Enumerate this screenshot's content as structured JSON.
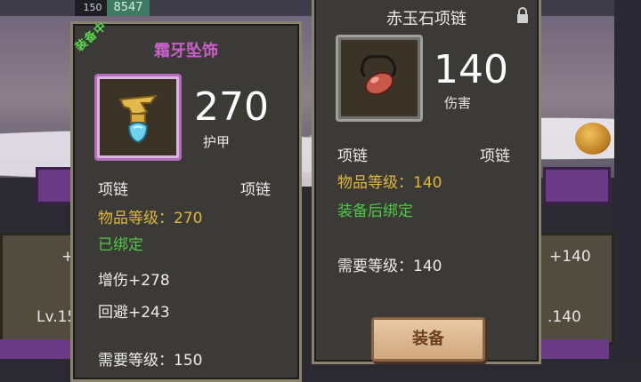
{
  "hud": {
    "level": "150",
    "exp": "8547"
  },
  "background": {
    "left_card": {
      "plus": "+",
      "level": "Lv.15"
    },
    "right_card": {
      "plus": "+140",
      "level": ".140"
    }
  },
  "left_item": {
    "badge": "装备中",
    "name": "霜牙坠饰",
    "name_color": "#c760c9",
    "icon": "frost-fang-pendant-icon",
    "stat_value": "270",
    "stat_label": "护甲",
    "type_left": "项链",
    "type_right": "项链",
    "item_level": "物品等级：270",
    "bind_status": "已绑定",
    "bonuses": [
      "增伤+278",
      "回避+243"
    ],
    "required_level": "需要等级：150"
  },
  "right_item": {
    "name": "赤玉石项链",
    "icon": "red-jade-necklace-icon",
    "lock_icon": "lock-icon",
    "stat_value": "140",
    "stat_label": "伤害",
    "type_left": "项链",
    "type_right": "项链",
    "item_level": "物品等级：140",
    "bind_status": "装备后绑定",
    "required_level": "需要等级：140",
    "equip_button": "装备"
  },
  "colors": {
    "purple_rarity": "#b56bbc",
    "gold_text": "#e0b63a",
    "green_text": "#4ec843"
  }
}
